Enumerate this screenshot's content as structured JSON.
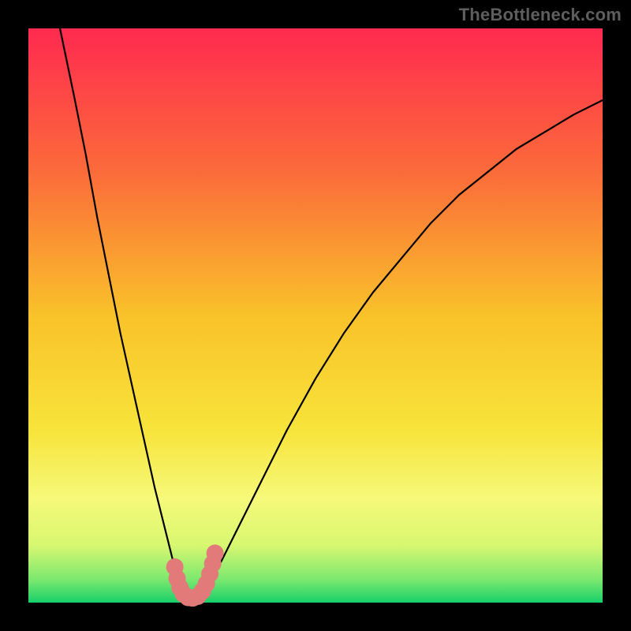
{
  "attribution": {
    "text": "TheBottleneck.com"
  },
  "colors": {
    "frame": "#000000",
    "curve": "#000000",
    "marker": "#e27a7a",
    "gradient_stops": [
      {
        "offset": 0.0,
        "color": "#ff2a4f"
      },
      {
        "offset": 0.25,
        "color": "#fb6b3a"
      },
      {
        "offset": 0.5,
        "color": "#f9c22a"
      },
      {
        "offset": 0.7,
        "color": "#f7e43a"
      },
      {
        "offset": 0.82,
        "color": "#f6f97a"
      },
      {
        "offset": 0.9,
        "color": "#d8f770"
      },
      {
        "offset": 0.96,
        "color": "#7be86f"
      },
      {
        "offset": 1.0,
        "color": "#18d06a"
      }
    ]
  },
  "chart_data": {
    "type": "line",
    "title": "",
    "xlabel": "",
    "ylabel": "",
    "xlim": [
      0,
      100
    ],
    "ylim": [
      0,
      100
    ],
    "series": [
      {
        "name": "bottleneck-curve",
        "x": [
          5.5,
          8,
          10,
          12,
          14,
          16,
          18,
          20,
          22,
          24,
          25.5,
          27,
          29,
          31,
          33,
          36,
          40,
          45,
          50,
          55,
          60,
          65,
          70,
          75,
          80,
          85,
          90,
          95,
          100
        ],
        "y": [
          100,
          88,
          78,
          67,
          57,
          47,
          38,
          29,
          20,
          12,
          6,
          2,
          0.5,
          2,
          6,
          12,
          20,
          30,
          39,
          47,
          54,
          60,
          66,
          71,
          75,
          79,
          82,
          85,
          87.5
        ]
      }
    ],
    "markers": {
      "name": "optimal-region",
      "x": [
        25.5,
        25.9,
        26.4,
        27,
        27.8,
        28.6,
        29.5,
        30.3,
        31,
        31.6,
        32.1,
        32.5
      ],
      "y": [
        6.2,
        4.2,
        2.6,
        1.5,
        0.9,
        0.8,
        1.1,
        2.0,
        3.3,
        5.0,
        6.8,
        8.6
      ]
    }
  }
}
